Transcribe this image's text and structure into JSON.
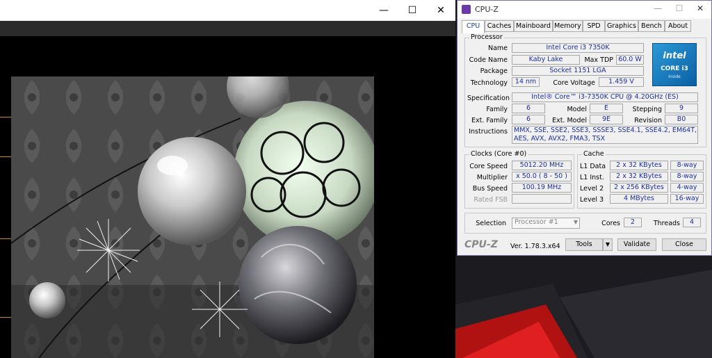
{
  "render_window": {
    "controls": {
      "minimize": "—",
      "maximize": "☐",
      "close": "✕"
    }
  },
  "cpuz": {
    "title": "CPU-Z",
    "controls": {
      "minimize": "—",
      "maximize": "☐",
      "close": "✕"
    },
    "tabs": [
      "CPU",
      "Caches",
      "Mainboard",
      "Memory",
      "SPD",
      "Graphics",
      "Bench",
      "About"
    ],
    "active_tab": "CPU",
    "processor": {
      "group_title": "Processor",
      "name_label": "Name",
      "name": "Intel Core i3 7350K",
      "code_name_label": "Code Name",
      "code_name": "Kaby Lake",
      "max_tdp_label": "Max TDP",
      "max_tdp": "60.0 W",
      "package_label": "Package",
      "package": "Socket 1151 LGA",
      "technology_label": "Technology",
      "technology": "14 nm",
      "core_voltage_label": "Core Voltage",
      "core_voltage": "1.459 V",
      "specification_label": "Specification",
      "specification": "Intel® Core™ i3-7350K CPU @ 4.20GHz (ES)",
      "family_label": "Family",
      "family": "6",
      "model_label": "Model",
      "model": "E",
      "stepping_label": "Stepping",
      "stepping": "9",
      "ext_family_label": "Ext. Family",
      "ext_family": "6",
      "ext_model_label": "Ext. Model",
      "ext_model": "9E",
      "revision_label": "Revision",
      "revision": "B0",
      "instructions_label": "Instructions",
      "instructions_line1": "MMX, SSE, SSE2, SSE3, SSSE3, SSE4.1, SSE4.2, EM64T, VT-x,",
      "instructions_line2": "AES, AVX, AVX2, FMA3, TSX",
      "logo": {
        "brand": "intel",
        "model": "CORE i3",
        "tag": "inside"
      }
    },
    "clocks": {
      "group_title": "Clocks (Core #0)",
      "core_speed_label": "Core Speed",
      "core_speed": "5012.20 MHz",
      "multiplier_label": "Multiplier",
      "multiplier": "x 50.0 ( 8 - 50 )",
      "bus_speed_label": "Bus Speed",
      "bus_speed": "100.19 MHz",
      "rated_fsb_label": "Rated FSB",
      "rated_fsb": ""
    },
    "cache": {
      "group_title": "Cache",
      "l1_data_label": "L1 Data",
      "l1_data": "2 x 32 KBytes",
      "l1_data_way": "8-way",
      "l1_inst_label": "L1 Inst.",
      "l1_inst": "2 x 32 KBytes",
      "l1_inst_way": "8-way",
      "level2_label": "Level 2",
      "level2": "2 x 256 KBytes",
      "level2_way": "4-way",
      "level3_label": "Level 3",
      "level3": "4 MBytes",
      "level3_way": "16-way"
    },
    "selection": {
      "label": "Selection",
      "value": "Processor #1",
      "cores_label": "Cores",
      "cores": "2",
      "threads_label": "Threads",
      "threads": "4"
    },
    "footer": {
      "brand": "CPU-Z",
      "version": "Ver. 1.78.3.x64",
      "tools": "Tools",
      "validate": "Validate",
      "close": "Close"
    }
  }
}
